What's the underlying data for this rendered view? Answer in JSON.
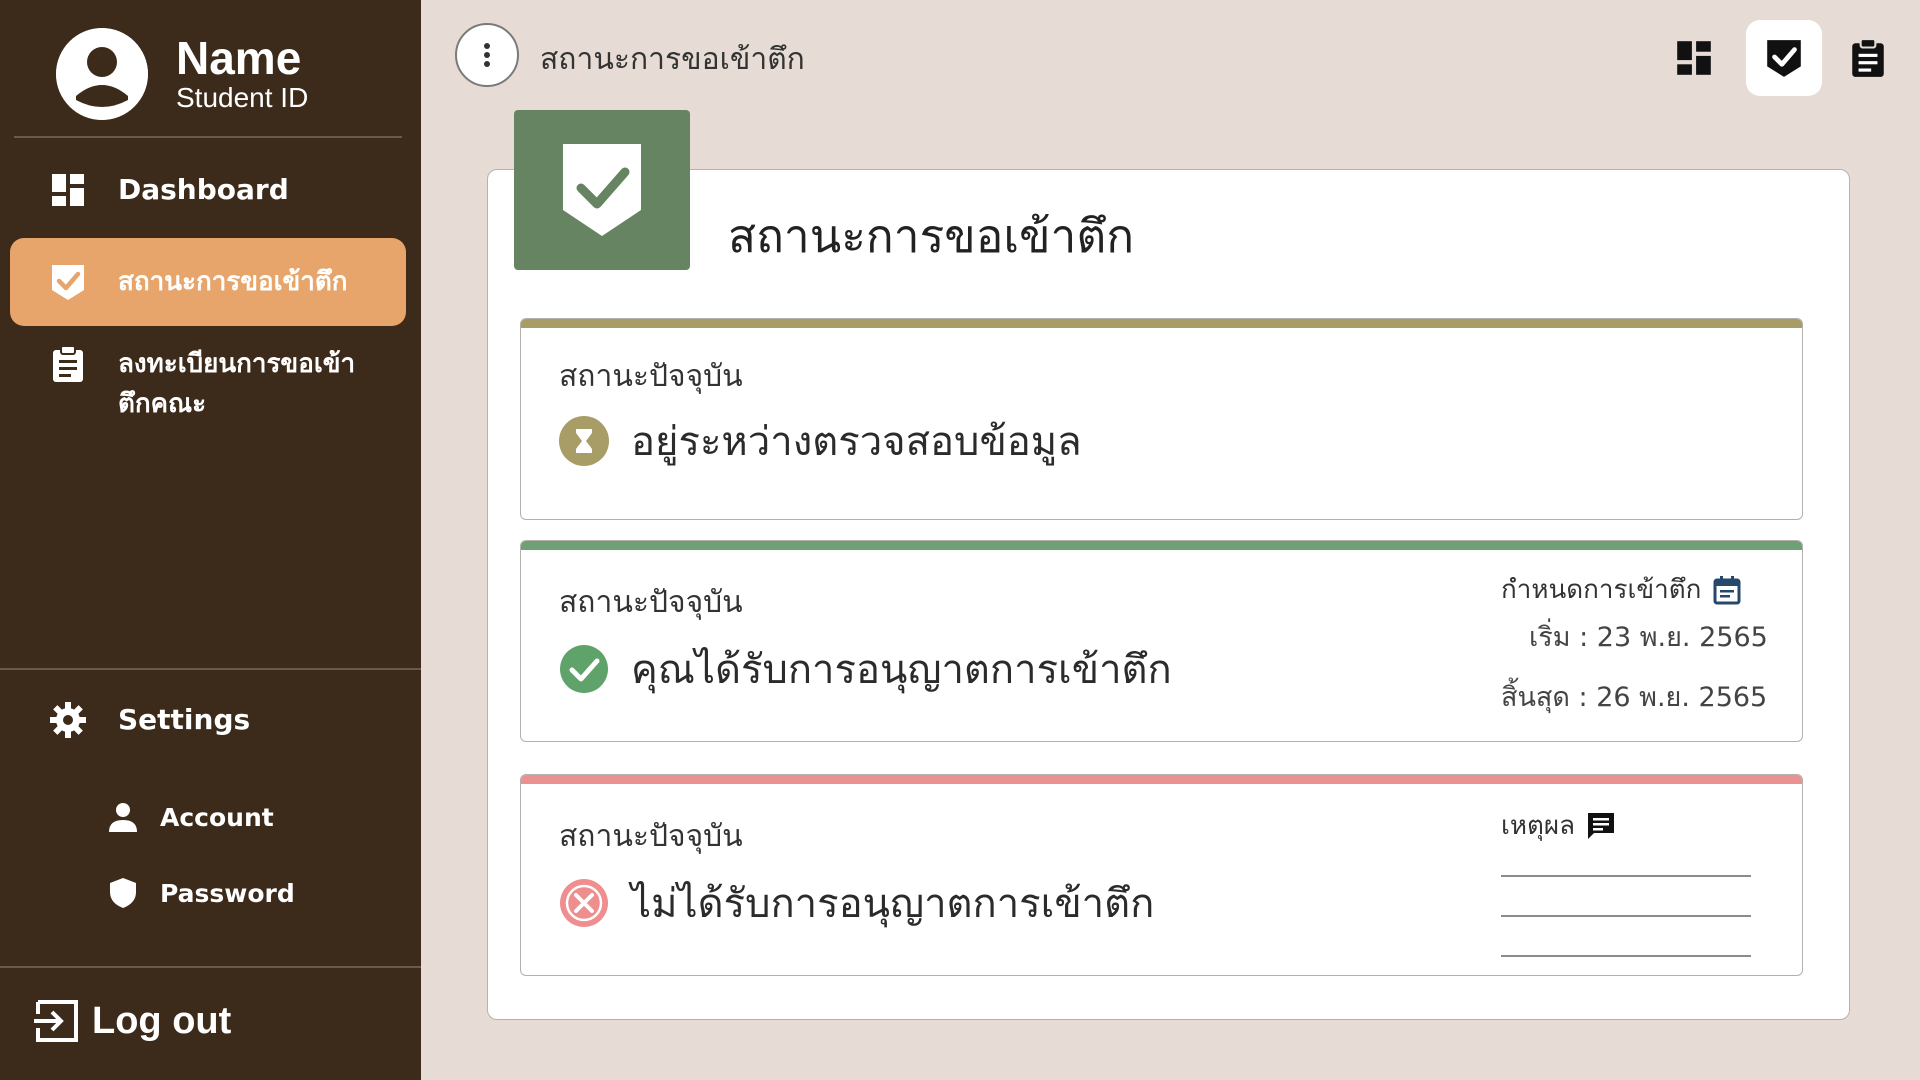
{
  "profile": {
    "name": "Name",
    "student_id": "Student ID"
  },
  "sidebar": {
    "items": [
      {
        "label": "Dashboard",
        "icon": "dashboard-icon"
      },
      {
        "label": "สถานะการขอเข้าตึก",
        "icon": "badge-check-icon",
        "active": true
      },
      {
        "label_line1": "ลงทะเบียนการขอเข้า",
        "label_line2": "ตึกคณะ",
        "icon": "clipboard-icon"
      }
    ],
    "settings": {
      "label": "Settings",
      "icon": "gear-icon"
    },
    "sub_items": [
      {
        "label": "Account",
        "icon": "person-icon"
      },
      {
        "label": "Password",
        "icon": "shield-icon"
      }
    ],
    "logout": {
      "label": "Log out",
      "icon": "logout-icon"
    }
  },
  "topbar": {
    "title": "สถานะการขอเข้าตึก",
    "icons": [
      "dashboard-icon",
      "badge-check-icon",
      "clipboard-icon"
    ],
    "active_icon": "badge-check-icon"
  },
  "page": {
    "title": "สถานะการขอเข้าตึก"
  },
  "status_cards": [
    {
      "label": "สถานะปัจจุบัน",
      "text": "อยู่ระหว่างตรวจสอบข้อมูล",
      "stripe_color": "#a99d67",
      "icon": "hourglass-icon",
      "icon_color": "#a99d67"
    },
    {
      "label": "สถานะปัจจุบัน",
      "text": "คุณได้รับการอนุญาตการเข้าตึก",
      "stripe_color": "#6f9f76",
      "icon": "check-circle-icon",
      "icon_color": "#5fa26a",
      "schedule": {
        "heading": "กำหนดการเข้าตึก",
        "icon": "calendar-icon",
        "start": "เริ่ม : 23 พ.ย. 2565",
        "end": "สิ้นสุด : 26 พ.ย. 2565"
      }
    },
    {
      "label": "สถานะปัจจุบัน",
      "text": "ไม่ได้รับการอนุญาตการเข้าตึก",
      "stripe_color": "#ea9292",
      "icon": "x-circle-icon",
      "icon_color": "#ef8e8e",
      "reason": {
        "heading": "เหตุผล",
        "icon": "comment-icon"
      }
    }
  ],
  "colors": {
    "sidebar_bg": "#3c2a1a",
    "active_nav": "#e8a56b",
    "page_bg": "#e6dcd5",
    "badge_tile": "#678462"
  }
}
